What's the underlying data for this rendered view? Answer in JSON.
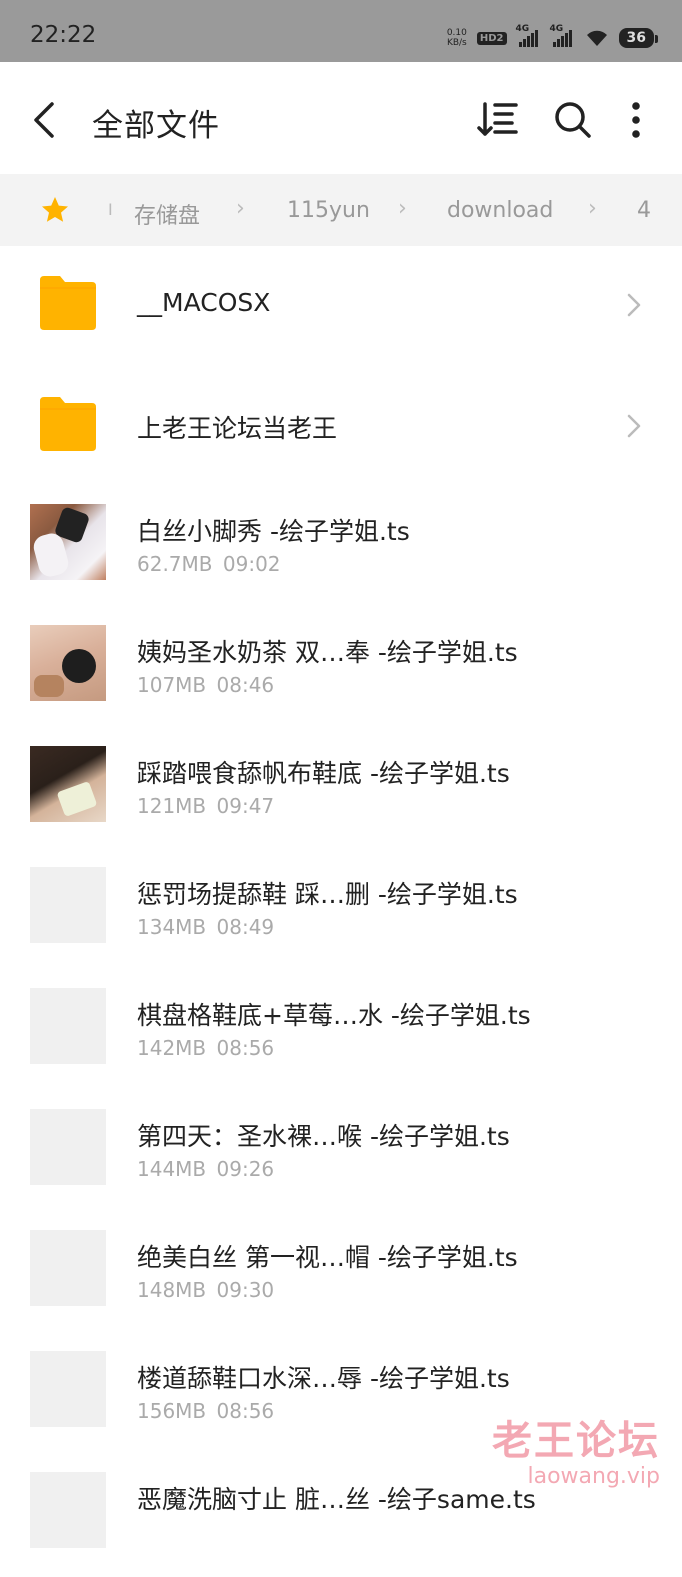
{
  "status": {
    "time": "22:22",
    "net_speed_value": "0.10",
    "net_speed_unit": "KB/s",
    "hd_label": "HD2",
    "sig1_label": "4G",
    "sig2_label": "4G",
    "battery": "36"
  },
  "header": {
    "title": "全部文件"
  },
  "breadcrumb": {
    "items": [
      "存储盘",
      "115yun",
      "download",
      "4"
    ],
    "divider": "I",
    "separator": "›"
  },
  "files": [
    {
      "type": "folder",
      "name": "__MACOSX"
    },
    {
      "type": "folder",
      "name": "上老王论坛当老王"
    },
    {
      "type": "video",
      "name": "白丝小脚秀 -绘子学姐.ts",
      "size": "62.7MB",
      "time": "09:02"
    },
    {
      "type": "video",
      "name": "姨妈圣水奶茶 双…奉 -绘子学姐.ts",
      "size": "107MB",
      "time": "08:46"
    },
    {
      "type": "video",
      "name": "踩踏喂食舔帆布鞋底 -绘子学姐.ts",
      "size": "121MB",
      "time": "09:47"
    },
    {
      "type": "video",
      "name": "惩罚场提舔鞋 踩…删 -绘子学姐.ts",
      "size": "134MB",
      "time": "08:49"
    },
    {
      "type": "video",
      "name": "棋盘格鞋底+草莓…水 -绘子学姐.ts",
      "size": "142MB",
      "time": "08:56"
    },
    {
      "type": "video",
      "name": "第四天：圣水裸…喉 -绘子学姐.ts",
      "size": "144MB",
      "time": "09:26"
    },
    {
      "type": "video",
      "name": "绝美白丝 第一视…帽 -绘子学姐.ts",
      "size": "148MB",
      "time": "09:30"
    },
    {
      "type": "video",
      "name": "楼道舔鞋口水深…辱 -绘子学姐.ts",
      "size": "156MB",
      "time": "08:56"
    },
    {
      "type": "video",
      "name": "恶魔洗脑寸止 脏…丝 -绘子same.ts",
      "size": "",
      "time": ""
    }
  ],
  "watermark": {
    "line1": "老王论坛",
    "line2": "laowang.vip"
  },
  "colors": {
    "folder": "#ffb300",
    "star": "#ffb300",
    "status_bar": "#9a9a9a",
    "breadcrumb_bg": "#f3f3f3",
    "watermark": "#f29aa6"
  }
}
